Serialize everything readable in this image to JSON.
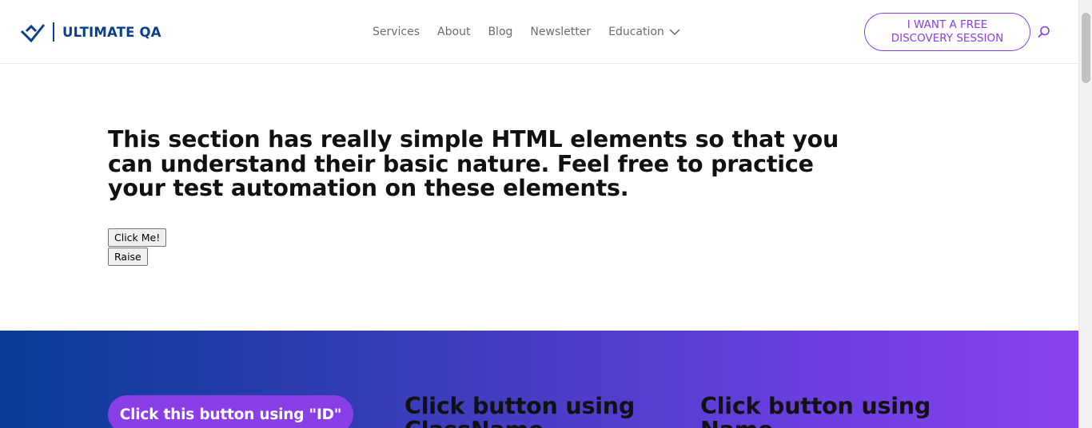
{
  "header": {
    "logo_text": "ULTIMATE QA",
    "nav": [
      "Services",
      "About",
      "Blog",
      "Newsletter",
      "Education"
    ],
    "cta_line1": "I WANT A FREE",
    "cta_line2": "DISCOVERY SESSION",
    "search_icon": "search-icon"
  },
  "intro": {
    "heading": "This section has really simple HTML elements so that you can understand their basic nature. Feel free to practice your test automation on these elements.",
    "button1": "Click Me!",
    "button2": "Raise"
  },
  "section2": {
    "id_button": "Click this button using \"ID\"",
    "col_a_title": "Click button using ClassName",
    "col_b_title": "Click button using Name"
  },
  "colors": {
    "brand_blue": "#0b3e8c",
    "accent_purple": "#8a3ee8",
    "gradient_start": "#083b95",
    "gradient_end": "#8a42f0"
  }
}
